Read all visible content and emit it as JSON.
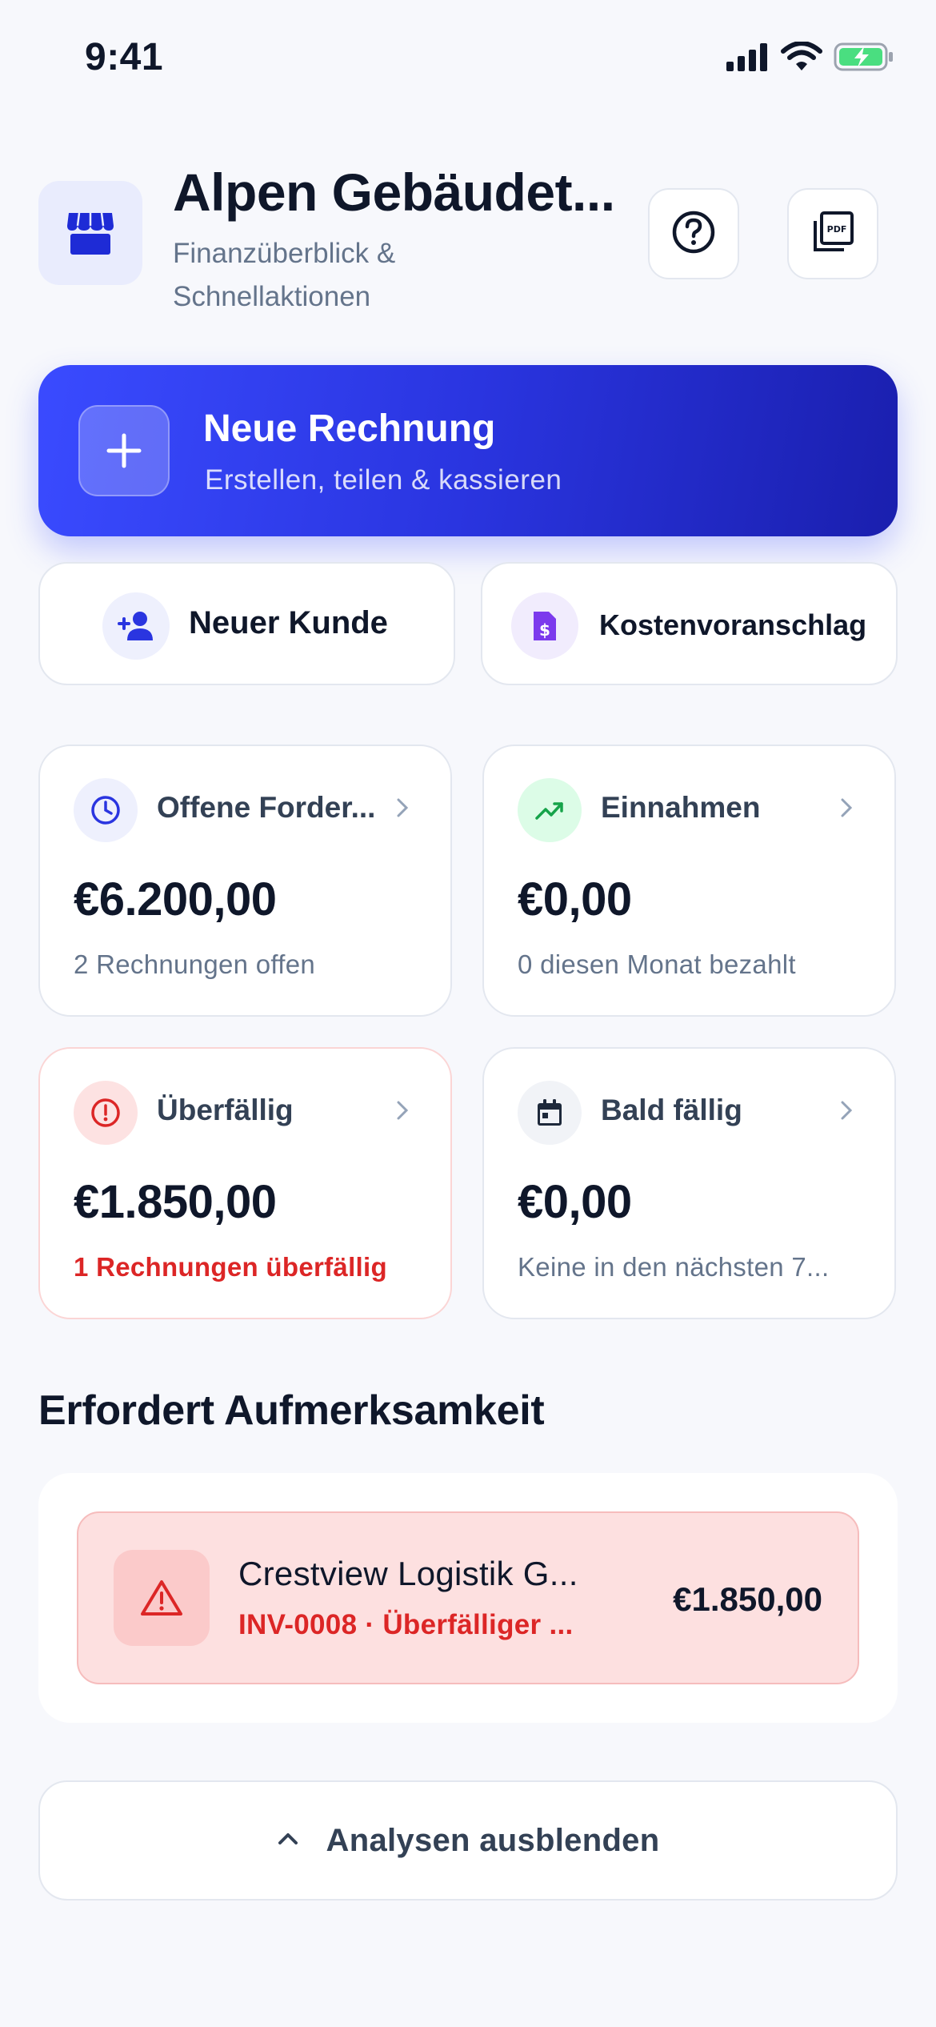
{
  "status_bar": {
    "time": "9:41",
    "icons": [
      "cellular-signal-icon",
      "wifi-icon",
      "battery-charging-icon"
    ]
  },
  "header": {
    "title": "Alpen Gebäudet...",
    "subtitle": "Finanzüberblick & Schnellaktionen",
    "store_icon": "storefront-icon",
    "help_icon": "help-circle-icon",
    "pdf_icon": "pdf-document-icon"
  },
  "primary_action": {
    "title": "Neue Rechnung",
    "subtitle": "Erstellen, teilen & kassieren",
    "icon": "plus-icon"
  },
  "secondary_actions": [
    {
      "label": "Neuer Kunde",
      "icon": "add-person-icon"
    },
    {
      "label": "Kostenvoranschlag",
      "icon": "estimate-document-icon"
    }
  ],
  "stats": [
    {
      "label": "Offene Forder...",
      "value": "€6.200,00",
      "sub": "2 Rechnungen offen",
      "icon": "clock-icon"
    },
    {
      "label": "Einnahmen",
      "value": "€0,00",
      "sub": "0 diesen Monat bezahlt",
      "icon": "trending-up-icon"
    },
    {
      "label": "Überfällig",
      "value": "€1.850,00",
      "sub": "1 Rechnungen überfällig",
      "icon": "alert-circle-icon"
    },
    {
      "label": "Bald fällig",
      "value": "€0,00",
      "sub": "Keine in den nächsten 7...",
      "icon": "calendar-icon"
    }
  ],
  "attention": {
    "title": "Erfordert Aufmerksamkeit",
    "items": [
      {
        "name": "Crestview Logistik G...",
        "meta": "INV-0008 · Überfälliger ...",
        "amount": "€1.850,00",
        "icon": "warning-triangle-icon"
      }
    ]
  },
  "toggle": {
    "label": "Analysen ausblenden",
    "icon": "chevron-up-icon"
  },
  "colors": {
    "accent": "#3a4bff",
    "accent_dark": "#1a1fae",
    "danger": "#dc2626",
    "success": "#16a34a",
    "muted": "#64748b",
    "background": "#f7f8fc"
  }
}
